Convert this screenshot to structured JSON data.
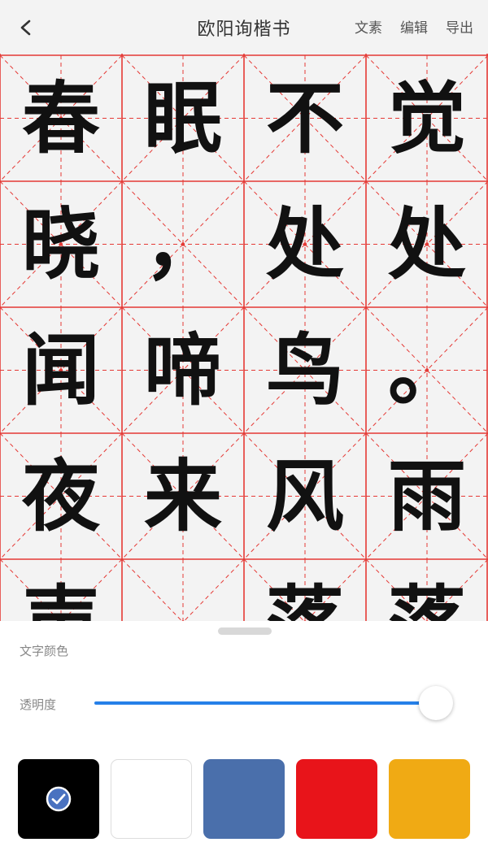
{
  "header": {
    "back_icon": "chevron-left-icon",
    "title": "欧阳询楷书",
    "actions": [
      "文素",
      "编辑",
      "导出"
    ]
  },
  "grid": {
    "columns": 4,
    "grid_color": "#e53935",
    "text_color": "#111111",
    "rows": [
      [
        "春",
        "眠",
        "不",
        "觉"
      ],
      [
        "晓",
        "，",
        "处",
        "处"
      ],
      [
        "闻",
        "啼",
        "鸟",
        "。"
      ],
      [
        "夜",
        "来",
        "风",
        "雨"
      ],
      [
        "声",
        "",
        "落",
        "落"
      ]
    ]
  },
  "panel": {
    "color_label": "文字颜色",
    "opacity_label": "透明度",
    "opacity_value": 1.0,
    "accent_color": "#2680e8",
    "swatches": [
      {
        "name": "black",
        "color": "#000000",
        "selected": true
      },
      {
        "name": "white",
        "color": "#ffffff",
        "selected": false
      },
      {
        "name": "blue",
        "color": "#4a6fab",
        "selected": false
      },
      {
        "name": "red",
        "color": "#e8141a",
        "selected": false
      },
      {
        "name": "yellow",
        "color": "#f0aa14",
        "selected": false
      }
    ],
    "check_icon": "check-circle-icon"
  }
}
